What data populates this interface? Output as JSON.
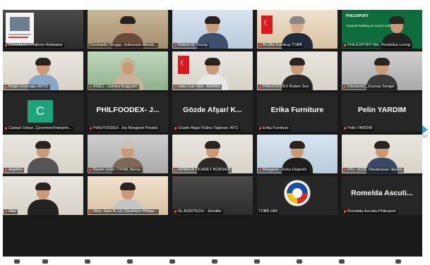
{
  "page": {
    "pager": "1/2"
  },
  "participants": [
    {
      "label": "Christianto's Fathom Notetaker",
      "muted": true,
      "kind": "logo"
    },
    {
      "label": "Christianto Tonggo, Indonesia Ministr...",
      "muted": false,
      "kind": "video",
      "active": true
    },
    {
      "label": "Robert M. Young",
      "muted": true,
      "kind": "video"
    },
    {
      "label": "M.Ülkü Karakuş TOBB",
      "muted": true,
      "kind": "video"
    },
    {
      "label": "PHILEXPORT-Ma. Flordeliza Leong",
      "muted": true,
      "kind": "video",
      "banner": "PHILEXPORT",
      "banner_tag": "Towards building an export nation"
    },
    {
      "label": "Belgin Kaoroglu-AKTO",
      "muted": true,
      "kind": "video"
    },
    {
      "label": "ASEC - Zahara Anggraini",
      "muted": true,
      "kind": "video"
    },
    {
      "label": "Halis Can Sire - ADASO",
      "muted": true,
      "kind": "video"
    },
    {
      "label": "PHILFOODEX Ruben See",
      "muted": true,
      "kind": "video"
    },
    {
      "label": "Interpreter_Zeynep Sengel",
      "muted": true,
      "kind": "video"
    },
    {
      "label": "Cankat Özkan, Çevirmen/Interpret...",
      "muted": true,
      "kind": "avatar",
      "initial": "C"
    },
    {
      "label": "PHILFOODEX- Joy Margaret Parado",
      "muted": true,
      "kind": "text",
      "display": "PHILFOODEX- J..."
    },
    {
      "label": "Gözde Afşar/ Kübra Taşkıran /ATO",
      "muted": true,
      "kind": "text",
      "display": "Gözde Afşar/ K..."
    },
    {
      "label": "Erika Furniture",
      "muted": true,
      "kind": "text",
      "display": "Erika Furniture"
    },
    {
      "label": "Pelin YARDIM",
      "muted": true,
      "kind": "text",
      "display": "Pelin YARDIM"
    },
    {
      "label": "akgöber",
      "muted": true,
      "kind": "video"
    },
    {
      "label": "Besim Özek / ITHIB, Bursa",
      "muted": true,
      "kind": "video"
    },
    {
      "label": "ISPARTA TİCARET BORSASI",
      "muted": true,
      "kind": "video"
    },
    {
      "label": "Margaret - Erika Dejarolo",
      "muted": true,
      "kind": "video"
    },
    {
      "label": "İTO - ICOC Uluslararası İlişkiler",
      "muted": true,
      "kind": "video"
    },
    {
      "label": "Hilal",
      "muted": true,
      "kind": "video"
    },
    {
      "label": "Mary Jane N. Uy (Southern Philipp...",
      "muted": true,
      "kind": "video"
    },
    {
      "label": "SL AGRITECH - Jennifer",
      "muted": true,
      "kind": "video"
    },
    {
      "label": "TOBB UİM",
      "muted": false,
      "kind": "seal"
    },
    {
      "label": "Romelda Ascutia-Philexport",
      "muted": true,
      "kind": "text",
      "display": "Romelda Ascuti..."
    }
  ]
}
